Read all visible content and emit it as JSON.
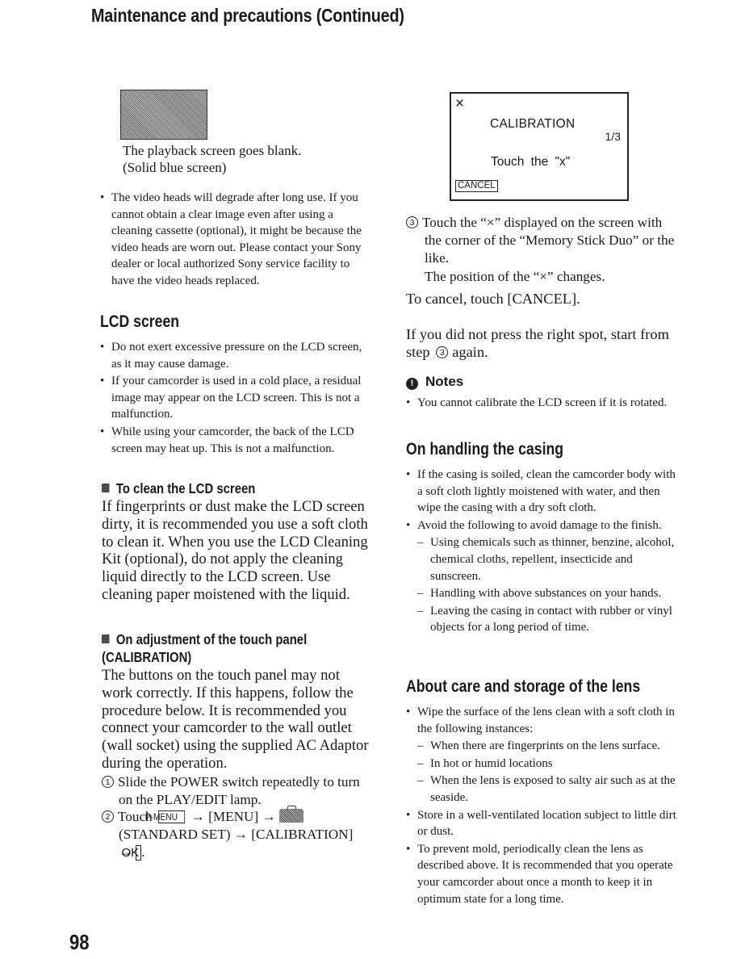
{
  "header": {
    "title": "Maintenance and precautions (Continued)"
  },
  "left": {
    "blank_screen_caption": [
      "The playback screen goes blank.",
      "(Solid blue screen)"
    ],
    "video_heads_note": "The video heads will degrade after long use. If you cannot obtain a clear image even after using a cleaning cassette (optional), it might be because the video heads are worn out. Please contact your Sony dealer or local authorized Sony service facility to have the video heads replaced.",
    "lcd_section": {
      "heading": "LCD screen",
      "bullets": [
        "Do not exert excessive pressure on the LCD screen, as it may cause damage.",
        "If your camcorder is used in a cold place, a residual image may appear on the LCD screen. This is not a malfunction.",
        "While using your camcorder, the back of the LCD screen may heat up. This is not a malfunction."
      ]
    },
    "clean_section": {
      "heading": "To clean the LCD screen",
      "body": "If fingerprints or dust make the LCD screen dirty, it is recommended you use a soft cloth to clean it. When you use the LCD Cleaning Kit (optional), do not apply the cleaning liquid directly to the LCD screen. Use cleaning paper moistened with the liquid."
    },
    "calibration_section": {
      "heading_line1": "On adjustment of the touch panel",
      "heading_line2": "(CALIBRATION)",
      "body": "The buttons on the touch panel may not work correctly. If this happens, follow the procedure below. It is recommended you connect your camcorder to the wall outlet (wall socket) using the supplied AC Adaptor during the operation.",
      "step1_num": "1",
      "step1": "Slide the POWER switch repeatedly to turn on the PLAY/EDIT lamp.",
      "step2_num": "2",
      "step2_touch": "Touch",
      "step2_pmenu": "P-MENU",
      "arrow": "→",
      "step2_menu": "[MENU]",
      "step2_standard_set": "(STANDARD SET)",
      "step2_calibration": "[CALIBRATION]",
      "step2_ok": "OK",
      "step2_end": "."
    }
  },
  "right": {
    "lcd_mock": {
      "x_mark": "×",
      "title": "CALIBRATION",
      "page": "1/3",
      "instruction": "Touch the \"x\"",
      "cancel_label": "CANCEL"
    },
    "step3_num": "3",
    "step3": "Touch the “×” displayed on the screen with the corner of the “Memory Stick Duo” or the like.",
    "step3_result": "The position of the “×” changes.",
    "cancel_text": "To cancel, touch [CANCEL].",
    "retry_text_a": "If you did not press the right spot, start from step",
    "retry_num": "3",
    "retry_text_b": "again.",
    "notes": {
      "icon": "!",
      "heading": "Notes",
      "bullets": [
        "You cannot calibrate the LCD screen if it is rotated."
      ]
    },
    "casing_section": {
      "heading": "On handling the casing",
      "bullet1": "If the casing is soiled, clean the camcorder body with a soft cloth lightly moistened with water, and then wipe the casing with a dry soft cloth.",
      "bullet2": "Avoid the following to avoid damage to the finish.",
      "dashes": [
        "Using chemicals such as thinner, benzine, alcohol, chemical cloths, repellent, insecticide and sunscreen.",
        "Handling with above substances on your hands.",
        "Leaving the casing in contact with rubber or vinyl objects for a long period of time."
      ]
    },
    "lens_section": {
      "heading": "About care and storage of the lens",
      "bullet1": "Wipe the surface of the lens clean with a soft cloth in the following instances:",
      "dashes": [
        "When there are fingerprints on the lens surface.",
        "In hot or humid locations",
        "When the lens is exposed to salty air such as at the seaside."
      ],
      "bullet2": "Store in a well-ventilated location subject to little dirt or dust.",
      "bullet3": "To prevent mold, periodically clean the lens as described above. It is recommended that you operate your camcorder about once a month to keep it in optimum state for a long time."
    }
  },
  "footer": {
    "page_number": "98"
  }
}
